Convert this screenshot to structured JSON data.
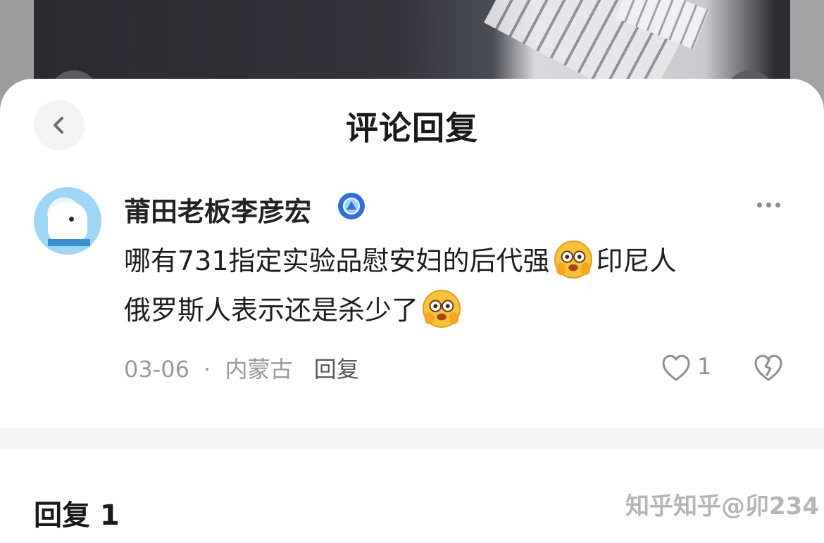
{
  "header": {
    "title": "评论回复"
  },
  "comment": {
    "author": "莆田老板李彦宏",
    "text_line1": "哪有731指定实验品慰安妇的后代强",
    "text_line1_tail": "印尼人",
    "text_line2": "俄罗斯人表示还是杀少了",
    "date": "03-06",
    "separator": "·",
    "location": "内蒙古",
    "reply_label": "回复",
    "like_count": "1"
  },
  "replies": {
    "header": "回复 1"
  },
  "watermark": "知乎知乎@卯234",
  "colors": {
    "badge": "#2f6fd6",
    "emoji": "#f7c23c"
  },
  "icons": [
    "chevron-left-icon",
    "verified-badge-icon",
    "more-icon",
    "heart-icon",
    "broken-heart-icon",
    "emoji-icon"
  ]
}
